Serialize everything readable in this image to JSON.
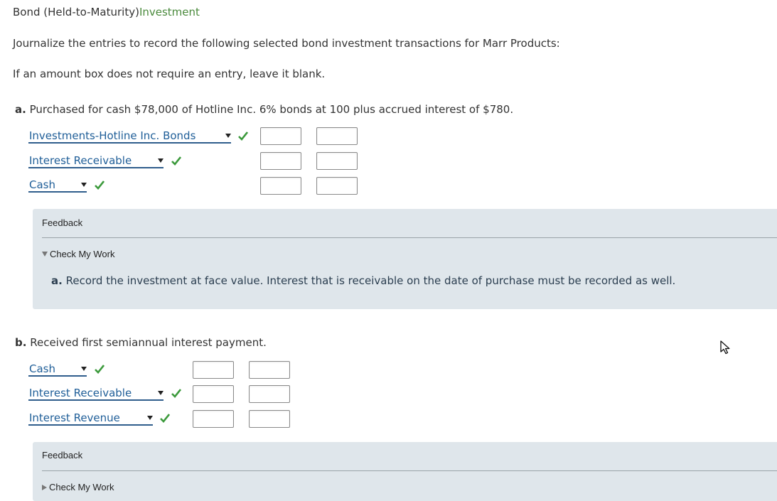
{
  "title": {
    "main": "Bond (Held-to-Maturity)",
    "accent": "Investment"
  },
  "instructions": {
    "line1": "Journalize the entries to record the following selected bond investment transactions for Marr Products:",
    "line2": "If an amount box does not require an entry, leave it blank."
  },
  "part_a": {
    "letter": "a.",
    "question": "Purchased for cash $78,000 of Hotline Inc. 6% bonds at 100 plus accrued interest of $780.",
    "rows": [
      {
        "account": "Investments-Hotline Inc. Bonds",
        "debit": "",
        "credit": ""
      },
      {
        "account": "Interest Receivable",
        "debit": "",
        "credit": ""
      },
      {
        "account": "Cash",
        "debit": "",
        "credit": ""
      }
    ],
    "feedback": {
      "title": "Feedback",
      "toggle": "Check My Work",
      "letter": "a.",
      "text": "Record the investment at face value. Interest that is receivable on the date of purchase must be recorded as well."
    }
  },
  "part_b": {
    "letter": "b.",
    "question": "Received first semiannual interest payment.",
    "rows": [
      {
        "account": "Cash",
        "debit": "",
        "credit": ""
      },
      {
        "account": "Interest Receivable",
        "debit": "",
        "credit": ""
      },
      {
        "account": "Interest Revenue",
        "debit": "",
        "credit": ""
      }
    ],
    "feedback": {
      "title": "Feedback",
      "toggle": "Check My Work"
    }
  },
  "colors": {
    "accent_green": "#4a8a3c",
    "link_blue": "#1f5e98",
    "check_green": "#3c9a3c",
    "feedback_bg": "#dfe6eb"
  },
  "icons": {
    "check": "check-icon",
    "caret": "caret-down-icon",
    "cursor": "mouse-pointer-icon"
  }
}
